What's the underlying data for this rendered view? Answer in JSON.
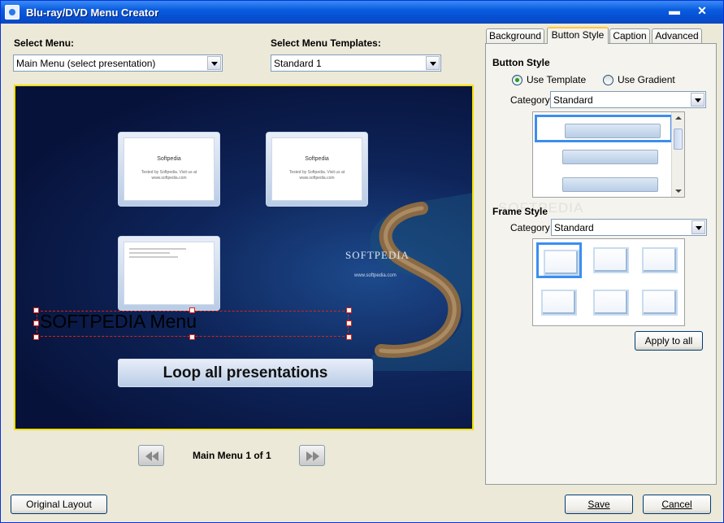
{
  "window": {
    "title": "Blu-ray/DVD Menu Creator",
    "minimize": "▬",
    "close": "✕"
  },
  "left": {
    "select_menu_label": "Select Menu:",
    "select_menu_value": "Main Menu (select presentation)",
    "select_template_label": "Select Menu Templates:",
    "select_template_value": "Standard 1"
  },
  "preview": {
    "thumbs": [
      {
        "title": "Softpedia",
        "sub": "Tested by Softpedia. Visit us at www.softpedia.com"
      },
      {
        "title": "Softpedia",
        "sub": "Tested by Softpedia. Visit us at www.softpedia.com"
      },
      {
        "title": "",
        "sub": ""
      }
    ],
    "watermark": "SOFTPEDIA",
    "watermark_url": "www.softpedia.com",
    "menu_title": "SOFTPEDIA Menu",
    "loop_button": "Loop all presentations"
  },
  "pager": {
    "label": "Main Menu 1 of 1"
  },
  "bottom": {
    "original_layout": "Original Layout",
    "save": "Save",
    "cancel": "Cancel"
  },
  "tabs": [
    {
      "label": "Background",
      "active": false
    },
    {
      "label": "Button Style",
      "active": true
    },
    {
      "label": "Caption",
      "active": false
    },
    {
      "label": "Advanced",
      "active": false
    }
  ],
  "button_style": {
    "title": "Button Style",
    "use_template": "Use Template",
    "use_gradient": "Use Gradient",
    "selected": "Use Template",
    "category_label": "Category",
    "category_value": "Standard"
  },
  "frame_style": {
    "title": "Frame Style",
    "category_label": "Category",
    "category_value": "Standard",
    "apply_all": "Apply to all"
  },
  "softpedia_watermark": "SOFTPEDIA",
  "colors": {
    "selection": "#3b8ef0",
    "title_bar": "#0a5ce0",
    "preview_border": "#f3e000"
  }
}
